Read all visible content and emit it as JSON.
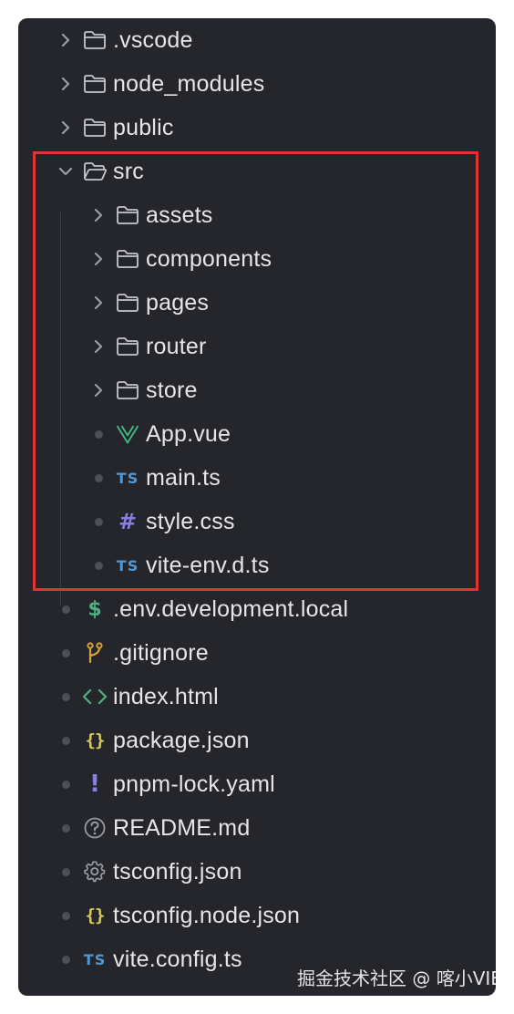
{
  "explorer": {
    "top_items": [
      {
        "name": ".vscode"
      },
      {
        "name": "node_modules"
      },
      {
        "name": "public"
      }
    ],
    "src_folder": {
      "name": "src",
      "expanded": true
    },
    "src_subfolders": [
      {
        "name": "assets"
      },
      {
        "name": "components"
      },
      {
        "name": "pages"
      },
      {
        "name": "router"
      },
      {
        "name": "store"
      }
    ],
    "src_files": [
      {
        "name": "App.vue",
        "icon": "vue-icon"
      },
      {
        "name": "main.ts",
        "icon": "typescript-icon"
      },
      {
        "name": "style.css",
        "icon": "css-hash-icon"
      },
      {
        "name": "vite-env.d.ts",
        "icon": "typescript-icon"
      }
    ],
    "root_files": [
      {
        "name": ".env.development.local",
        "icon": "dollar-icon"
      },
      {
        "name": ".gitignore",
        "icon": "git-branch-icon"
      },
      {
        "name": "index.html",
        "icon": "html-brackets-icon"
      },
      {
        "name": "package.json",
        "icon": "json-braces-icon"
      },
      {
        "name": "pnpm-lock.yaml",
        "icon": "yaml-exclamation-icon"
      },
      {
        "name": "README.md",
        "icon": "question-circle-icon"
      },
      {
        "name": "tsconfig.json",
        "icon": "gear-icon"
      },
      {
        "name": "tsconfig.node.json",
        "icon": "json-braces-icon"
      },
      {
        "name": "vite.config.ts",
        "icon": "typescript-icon"
      }
    ]
  },
  "icon_text": {
    "ts": "TS",
    "hash": "#",
    "dollar": "$",
    "braces": "{}",
    "excl": "!"
  },
  "colors": {
    "background": "#25262b",
    "text": "#e6e6e6",
    "highlight_border": "#e2342c",
    "typescript": "#4f98d6",
    "vue": "#41b883",
    "json": "#d9c65e",
    "git": "#d8a23c"
  },
  "watermark": "掘金技术社区 @ 喀小VIE"
}
